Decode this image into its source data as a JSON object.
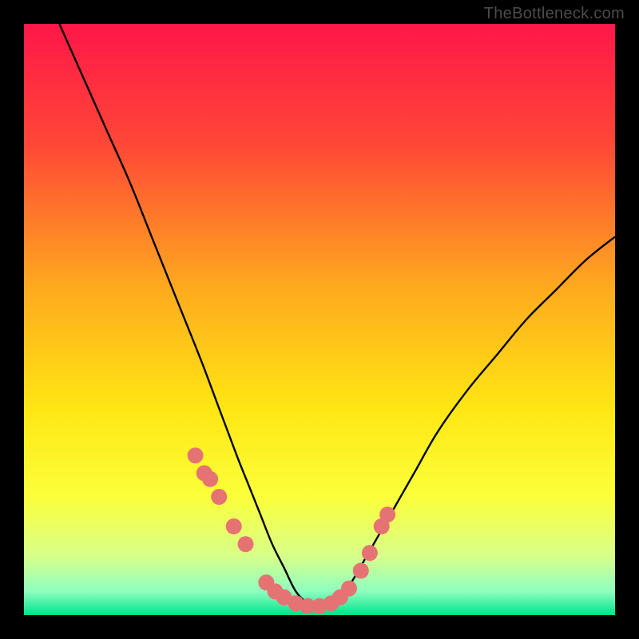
{
  "watermark": "TheBottleneck.com",
  "chart_data": {
    "type": "line",
    "title": "",
    "xlabel": "",
    "ylabel": "",
    "xlim": [
      0,
      100
    ],
    "ylim": [
      0,
      100
    ],
    "background_gradient": {
      "stops": [
        {
          "pos": 0.0,
          "color": "#ff1749"
        },
        {
          "pos": 0.2,
          "color": "#ff4637"
        },
        {
          "pos": 0.45,
          "color": "#ffab1e"
        },
        {
          "pos": 0.65,
          "color": "#ffe613"
        },
        {
          "pos": 0.8,
          "color": "#fbff3a"
        },
        {
          "pos": 0.9,
          "color": "#d8ff8a"
        },
        {
          "pos": 0.96,
          "color": "#8effc0"
        },
        {
          "pos": 1.0,
          "color": "#00e38a"
        }
      ]
    },
    "series": [
      {
        "name": "bottleneck-curve",
        "color": "#000000",
        "x": [
          6,
          10,
          14,
          18,
          22,
          26,
          30,
          33,
          36,
          38,
          40,
          42,
          44,
          46,
          48,
          50,
          52,
          55,
          58,
          62,
          66,
          70,
          75,
          80,
          85,
          90,
          95,
          100
        ],
        "y": [
          100,
          91,
          82,
          73,
          63,
          53,
          43,
          35,
          27,
          22,
          17,
          12,
          8,
          4,
          2,
          1,
          2,
          5,
          10,
          17,
          24,
          31,
          38,
          44,
          50,
          55,
          60,
          64
        ]
      }
    ],
    "points": {
      "name": "curve-dots",
      "color": "#e57373",
      "radius": 10,
      "x": [
        29.0,
        30.5,
        31.5,
        33.0,
        35.5,
        37.5,
        41.0,
        42.5,
        44.0,
        46.0,
        48.0,
        50.0,
        52.0,
        53.5,
        55.0,
        57.0,
        58.5,
        60.5,
        61.5
      ],
      "y": [
        27.0,
        24.0,
        23.0,
        20.0,
        15.0,
        12.0,
        5.5,
        4.0,
        3.0,
        2.0,
        1.5,
        1.5,
        2.0,
        3.0,
        4.5,
        7.5,
        10.5,
        15.0,
        17.0
      ]
    }
  }
}
